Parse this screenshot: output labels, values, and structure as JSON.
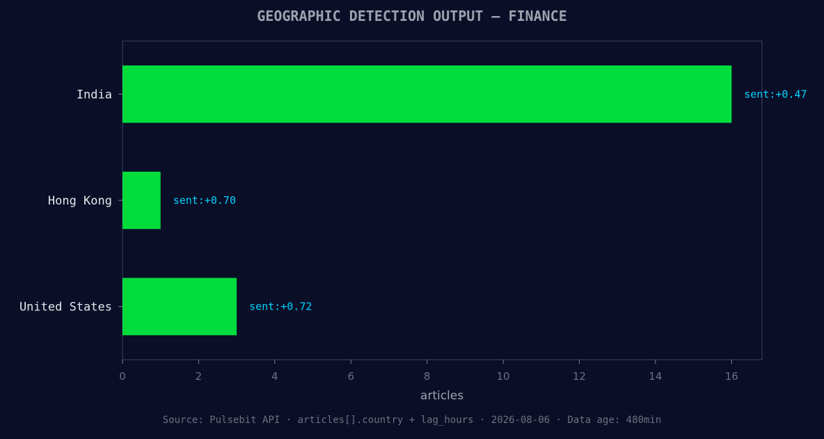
{
  "chart_data": {
    "type": "bar",
    "orientation": "horizontal",
    "title": "GEOGRAPHIC DETECTION OUTPUT — FINANCE",
    "xlabel": "articles",
    "ylabel": "",
    "categories": [
      "India",
      "Hong Kong",
      "United States"
    ],
    "values": [
      16,
      1,
      3
    ],
    "data_labels": [
      "sent:+0.47",
      "sent:+0.70",
      "sent:+0.72"
    ],
    "xlim": [
      0,
      16.8
    ],
    "xticks": [
      0,
      2,
      4,
      6,
      8,
      10,
      12,
      14,
      16
    ],
    "grid": false,
    "legend": "none",
    "source": "Source: Pulsebit API · articles[].country + lag_hours · 2026-08-06 · Data age: 480min"
  },
  "colors": {
    "background": "#0a0e27",
    "bar": "#00dc3c",
    "data_label": "#00d4ff",
    "frame": "#2a3050",
    "text": "#e5e7eb",
    "muted": "#6b7280"
  }
}
